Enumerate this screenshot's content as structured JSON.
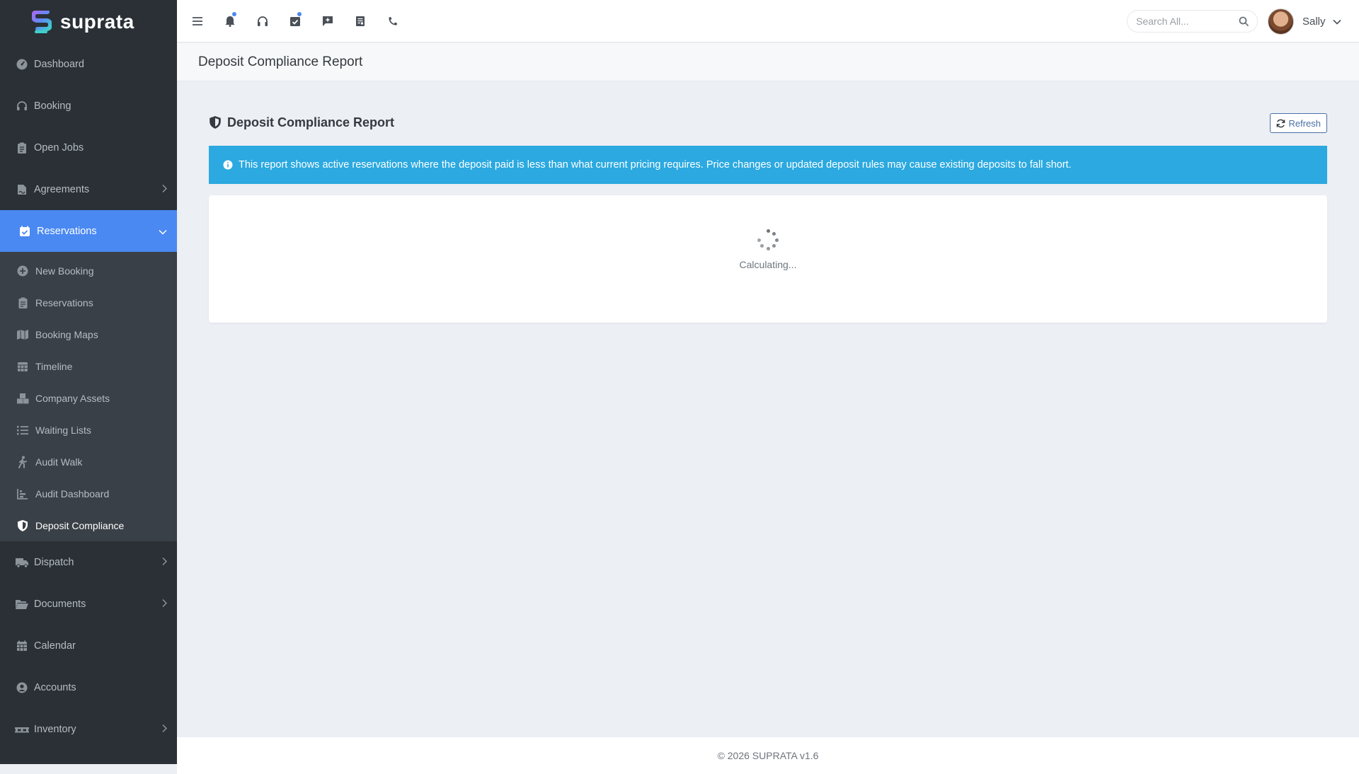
{
  "brand": {
    "name": "suprata"
  },
  "sidebar": {
    "items": [
      {
        "label": "Dashboard",
        "icon": "gauge-icon"
      },
      {
        "label": "Booking",
        "icon": "headset-icon"
      },
      {
        "label": "Open Jobs",
        "icon": "clipboard-icon"
      },
      {
        "label": "Agreements",
        "icon": "file-signature-icon",
        "expandable": true
      },
      {
        "label": "Reservations",
        "icon": "calendar-check-icon",
        "expanded": true
      },
      {
        "label": "Dispatch",
        "icon": "truck-icon",
        "expandable": true
      },
      {
        "label": "Documents",
        "icon": "folder-open-icon",
        "expandable": true
      },
      {
        "label": "Calendar",
        "icon": "calendar-icon"
      },
      {
        "label": "Accounts",
        "icon": "user-circle-icon"
      },
      {
        "label": "Inventory",
        "icon": "pallet-icon",
        "expandable": true
      }
    ],
    "reservations_sub": [
      {
        "label": "New Booking",
        "icon": "plus-circle-icon"
      },
      {
        "label": "Reservations",
        "icon": "clipboard-list-icon"
      },
      {
        "label": "Booking Maps",
        "icon": "map-icon"
      },
      {
        "label": "Timeline",
        "icon": "calendar-grid-icon"
      },
      {
        "label": "Company Assets",
        "icon": "boxes-icon"
      },
      {
        "label": "Waiting Lists",
        "icon": "list-icon"
      },
      {
        "label": "Audit Walk",
        "icon": "walking-icon"
      },
      {
        "label": "Audit Dashboard",
        "icon": "chart-bar-icon"
      },
      {
        "label": "Deposit Compliance",
        "icon": "shield-icon",
        "current": true
      }
    ]
  },
  "topbar": {
    "icons": [
      "menu-icon",
      "bell-icon",
      "headphones-icon",
      "task-icon",
      "chat-plus-icon",
      "receipt-icon",
      "phone-icon"
    ],
    "search": {
      "placeholder": "Search All..."
    },
    "user": {
      "name": "Sally"
    }
  },
  "page": {
    "title": "Deposit Compliance Report"
  },
  "report": {
    "title": "Deposit Compliance Report",
    "refresh_label": "Refresh",
    "info_text": "This report shows active reservations where the deposit paid is less than what current pricing requires. Price changes or updated deposit rules may cause existing deposits to fall short.",
    "loading_text": "Calculating..."
  },
  "footer": {
    "text": "© 2026 SUPRATA v1.6"
  },
  "colors": {
    "sidebar_bg": "#2a3036",
    "accent": "#4a89f2",
    "info": "#2ba9e0"
  }
}
